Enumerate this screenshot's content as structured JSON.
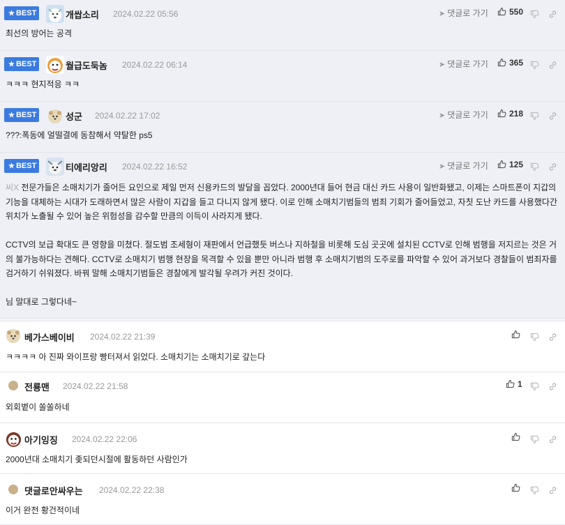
{
  "best_label": "BEST",
  "reply_label": "댓글로 가기",
  "best_comments": [
    {
      "nick": "개쌉소리",
      "date": "2024.02.22 05:56",
      "likes": "550",
      "lines": [
        "최선의 방어는 공격"
      ]
    },
    {
      "nick": "월급도둑놈",
      "date": "2024.02.22 06:14",
      "likes": "365",
      "lines": [
        "ㅋㅋㅋ 현지적응 ㅋㅋ"
      ]
    },
    {
      "nick": "성군",
      "date": "2024.02.22 17:02",
      "likes": "218",
      "lines": [
        "???:폭동에 얼떨결에 동참해서 약탈한 ps5"
      ]
    },
    {
      "nick": "티에리앙리",
      "date": "2024.02.22 16:52",
      "likes": "125",
      "prefix": "씨X",
      "paragraphs": [
        " 전문가들은 소매치기가 줄어든 요인으로 제일 먼저 신용카드의 발달을 꼽았다. 2000년대 들어 현금 대신 카드 사용이 일반화됐고, 이제는 스마트폰이 지갑의 기능을 대체하는 시대가 도래하면서 많은 사람이 지갑을 들고 다니지 않게 됐다. 이로 인해 소매치기범들의 범죄 기회가 줄어들었고, 자칫 도난 카드를 사용했다간 위치가 노출될 수 있어 높은 위험성을 감수할 만큼의 이득이 사라지게 됐다.",
        "CCTV의 보급 확대도 큰 영향을 미쳤다. 절도범 조세형이 재판에서 언급했듯 버스나 지하철을 비롯해 도심 곳곳에 설치된 CCTV로 인해 범행을 저지르는 것은 거의 불가능하다는 견해다. CCTV로 소매치기 범행 현장을 목격할 수 있을 뿐만 아니라 범행 후 소매치기범의 도주로를 파악할 수 있어 과거보다 경찰들이 범죄자를 검거하기 쉬워졌다. 바꿔 말해 소매치기범들은 경찰에게 발각될 우려가 커진 것이다.",
        "님 말대로 그렇다네~"
      ]
    }
  ],
  "comments": [
    {
      "nick": "베가스베이비",
      "date": "2024.02.22 21:39",
      "likes": "",
      "text": "ㅋㅋㅋㅋ 아 진짜 와이프랑 빵터져서 읽었다. 소매치기는 소매치기로 갚는다"
    },
    {
      "nick": "전룡맨",
      "date": "2024.02.22 21:58",
      "likes": "1",
      "text": "외회볕이 쏠쏠하네"
    },
    {
      "nick": "아기잉징",
      "date": "2024.02.22 22:06",
      "likes": "",
      "text": "2000년대 소매치기 좇되던시절에 활동하던 사람인가"
    },
    {
      "nick": "댓글로안싸우는",
      "date": "2024.02.22 22:38",
      "likes": "",
      "text": "이거 완전 황건적이네"
    }
  ],
  "icons": {
    "like": "thumbs-up-icon",
    "dislike": "thumbs-down-icon",
    "share": "link-icon",
    "reply": "arrow-icon"
  },
  "colors": {
    "best_badge": "#3b7be0",
    "best_bg": "#eef0f6",
    "divider": "#e2e4ea"
  }
}
